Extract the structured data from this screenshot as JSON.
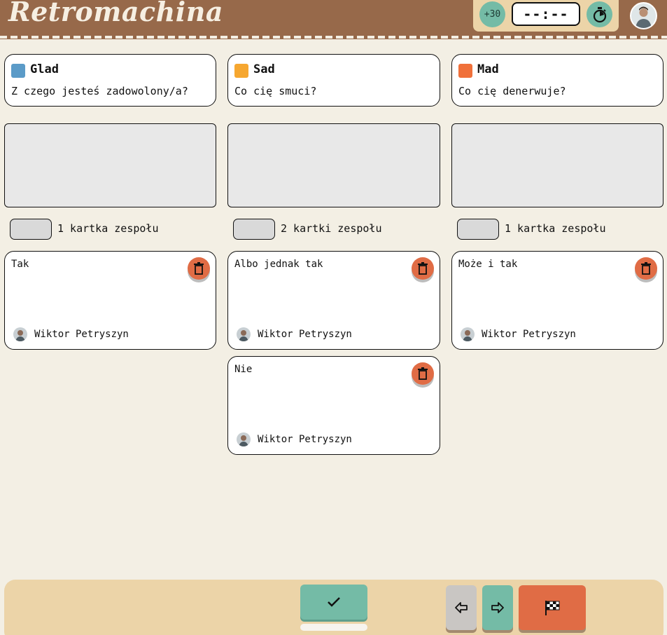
{
  "app": {
    "title": "Retromachina"
  },
  "timer": {
    "add_label": "+30",
    "display": "--:--"
  },
  "columns": [
    {
      "title": "Glad",
      "prompt": "Z czego jesteś zadowolony/a?",
      "color": "#5b9bc8",
      "count_label": "1 kartka zespołu",
      "cards": [
        {
          "text": "Tak",
          "author": "Wiktor Petryszyn"
        }
      ]
    },
    {
      "title": "Sad",
      "prompt": "Co cię smuci?",
      "color": "#f6a730",
      "count_label": "2 kartki zespołu",
      "cards": [
        {
          "text": "Albo jednak tak",
          "author": "Wiktor Petryszyn"
        },
        {
          "text": "Nie",
          "author": "Wiktor Petryszyn"
        }
      ]
    },
    {
      "title": "Mad",
      "prompt": "Co cię denerwuje?",
      "color": "#f0703a",
      "count_label": "1 kartka zespołu",
      "cards": [
        {
          "text": "Może i tak",
          "author": "Wiktor Petryszyn"
        }
      ]
    }
  ],
  "colors": {
    "header": "#97694a",
    "accent_green": "#74bba6",
    "accent_orange": "#e06c45",
    "panel": "#ecd4a8",
    "background": "#f3efe4"
  },
  "icons": {
    "stopwatch": "stopwatch-icon",
    "delete": "trash-icon",
    "ready": "checkmark-icon",
    "prev": "arrow-left-icon",
    "next": "arrow-right-icon",
    "finish": "checkered-flag-icon"
  }
}
